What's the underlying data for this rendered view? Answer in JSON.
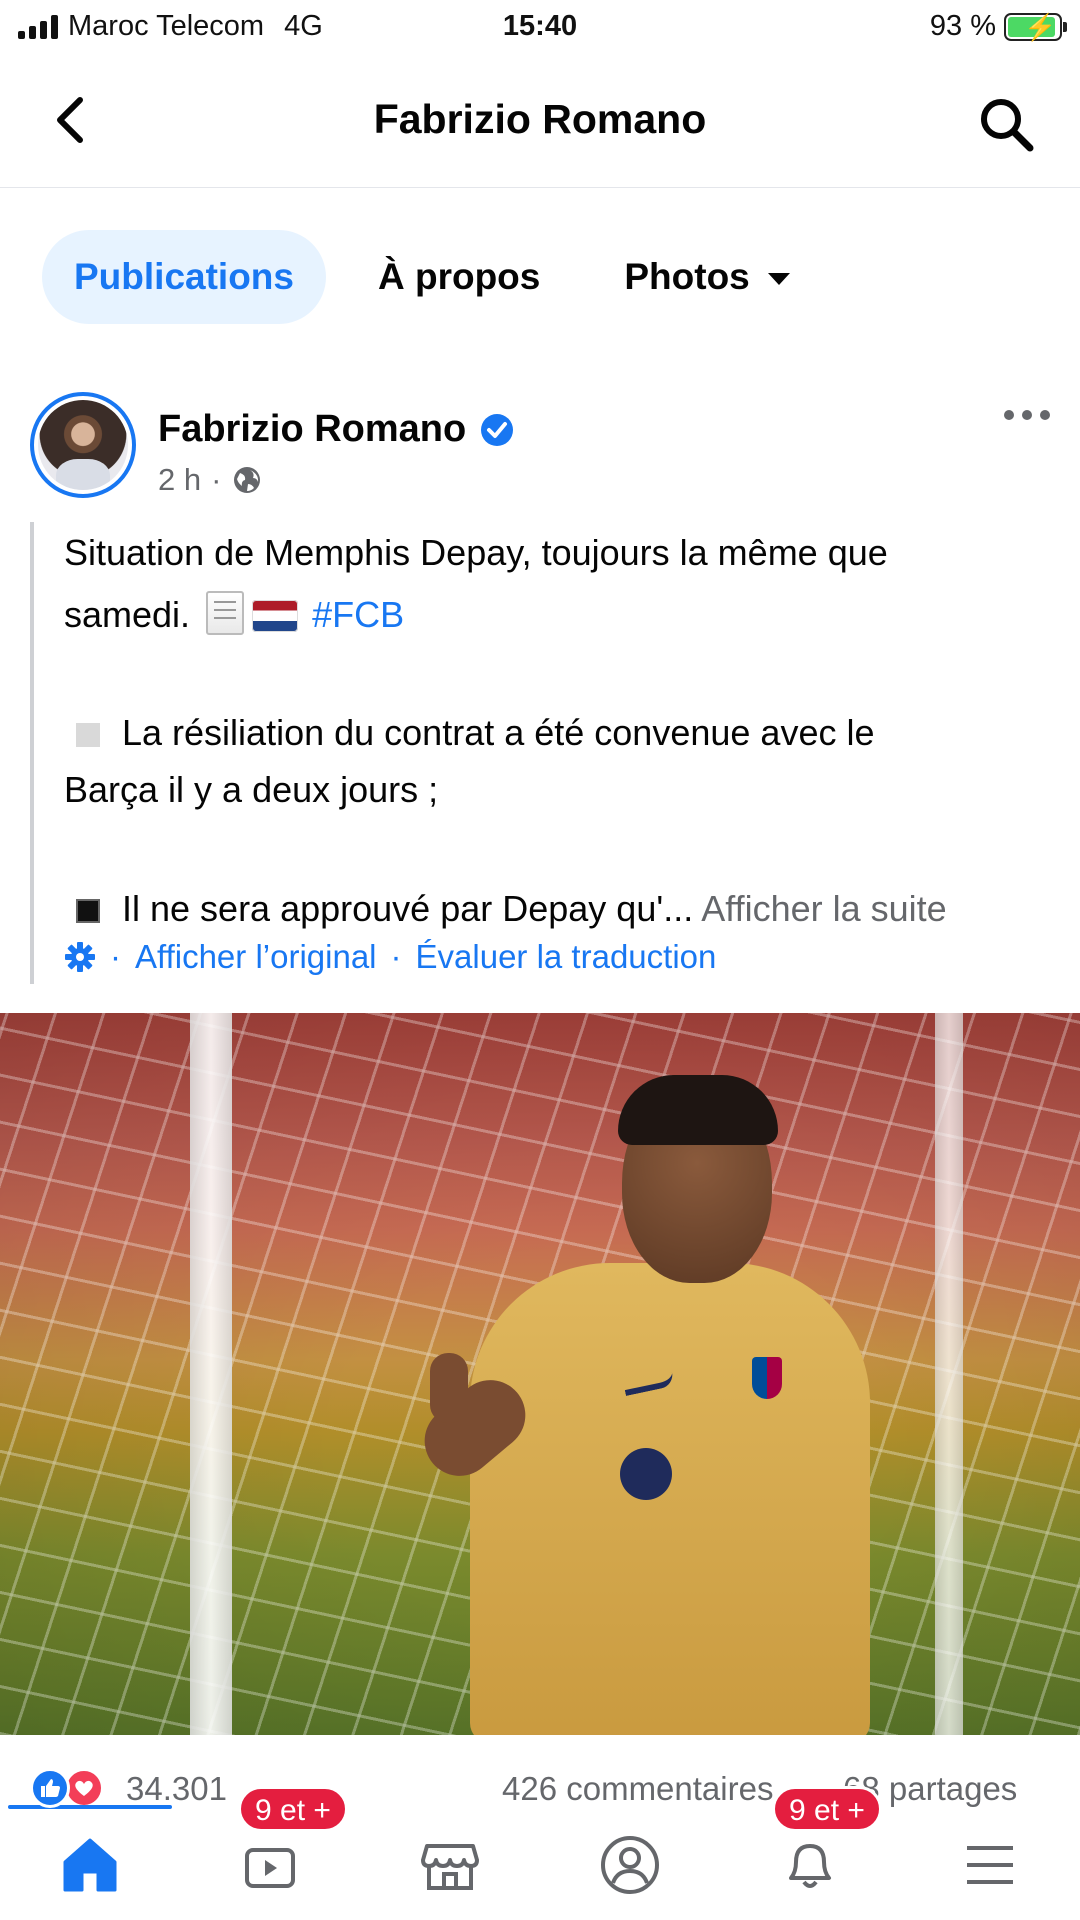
{
  "status_bar": {
    "carrier": "Maroc Telecom",
    "network": "4G",
    "time": "15:40",
    "battery": "93 %",
    "battery_level": 0.93
  },
  "header": {
    "title": "Fabrizio Romano",
    "back_icon": "chevron-left-icon",
    "search_icon": "search-icon"
  },
  "tabs": [
    {
      "label": "Publications",
      "active": true
    },
    {
      "label": "À propos",
      "active": false
    },
    {
      "label": "Photos",
      "active": false
    }
  ],
  "post": {
    "author": "Fabrizio Romano",
    "verified": true,
    "time": "2 h",
    "meta_sep": "·",
    "text": {
      "line1": "Situation de Memphis Depay, toujours la même que",
      "line2": "samedi.",
      "hashtag": "#FCB",
      "line3": "La résiliation du contrat a été convenue avec le",
      "line4": "Barça il y a deux jours ;",
      "line5": "Il ne sera approuvé par Depay qu'...",
      "see_more": "Afficher la suite"
    },
    "translation": {
      "show_original": "Afficher l’original",
      "rate_translation": "Évaluer la traduction",
      "sep": "·"
    },
    "reactions": {
      "count": "34.301",
      "comments": "426 commentaires",
      "shares": "68 partages"
    }
  },
  "bottom_nav": {
    "items": [
      {
        "icon": "home-icon",
        "active": true,
        "badge": ""
      },
      {
        "icon": "video-icon",
        "active": false,
        "badge": "9 et +"
      },
      {
        "icon": "marketplace-icon",
        "active": false,
        "badge": ""
      },
      {
        "icon": "profile-icon",
        "active": false,
        "badge": ""
      },
      {
        "icon": "bell-icon",
        "active": false,
        "badge": "9 et +"
      },
      {
        "icon": "menu-icon",
        "active": false,
        "badge": ""
      }
    ]
  },
  "colors": {
    "accent": "#1877f2",
    "active_tab_bg": "#e7f3ff",
    "badge": "#e41e3f",
    "secondary_text": "#65676b"
  }
}
